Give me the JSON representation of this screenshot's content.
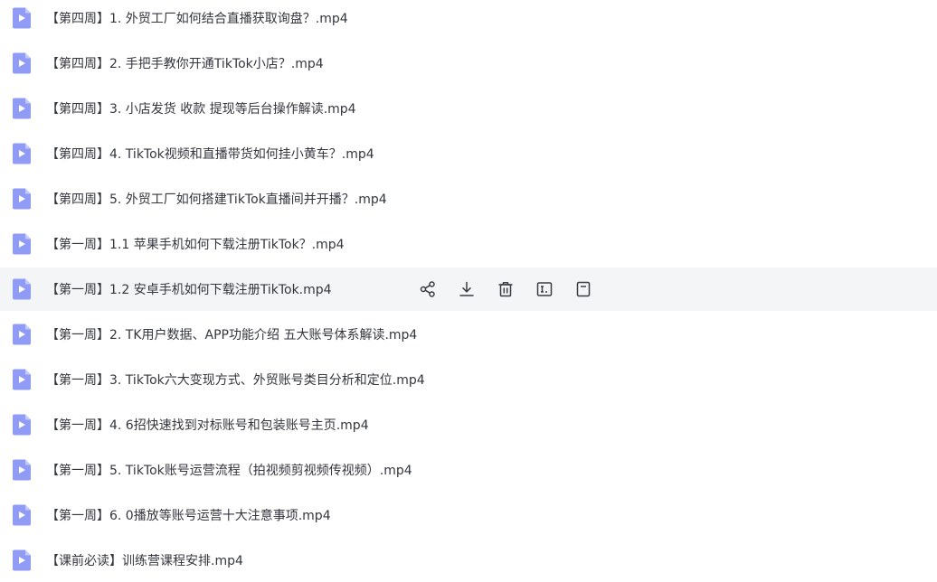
{
  "files": [
    {
      "name": "【第四周】1. 外贸工厂如何结合直播获取询盘？.mp4",
      "icon": "video-file-icon"
    },
    {
      "name": "【第四周】2. 手把手教你开通TikTok小店？.mp4",
      "icon": "video-file-icon"
    },
    {
      "name": "【第四周】3. 小店发货 收款 提现等后台操作解读.mp4",
      "icon": "video-file-icon"
    },
    {
      "name": "【第四周】4. TikTok视频和直播带货如何挂小黄车？.mp4",
      "icon": "video-file-icon"
    },
    {
      "name": "【第四周】5. 外贸工厂如何搭建TikTok直播间并开播？.mp4",
      "icon": "video-file-icon"
    },
    {
      "name": "【第一周】1.1 苹果手机如何下载注册TikTok？.mp4",
      "icon": "video-file-icon"
    },
    {
      "name": "【第一周】1.2 安卓手机如何下载注册TikTok.mp4",
      "icon": "video-file-icon"
    },
    {
      "name": "【第一周】2. TK用户数据、APP功能介绍 五大账号体系解读.mp4",
      "icon": "video-file-icon"
    },
    {
      "name": "【第一周】3. TikTok六大变现方式、外贸账号类目分析和定位.mp4",
      "icon": "video-file-icon"
    },
    {
      "name": "【第一周】4. 6招快速找到对标账号和包装账号主页.mp4",
      "icon": "video-file-icon"
    },
    {
      "name": "【第一周】5. TikTok账号运营流程（拍视频剪视频传视频）.mp4",
      "icon": "video-file-icon"
    },
    {
      "name": "【第一周】6. 0播放等账号运营十大注意事项.mp4",
      "icon": "video-file-icon"
    },
    {
      "name": "【课前必读】训练营课程安排.mp4",
      "icon": "video-file-icon"
    }
  ],
  "hovered_index": 6,
  "row_actions": [
    {
      "action": "share",
      "icon": "share-icon"
    },
    {
      "action": "download",
      "icon": "download-icon"
    },
    {
      "action": "delete",
      "icon": "trash-icon"
    },
    {
      "action": "rename",
      "icon": "rename-icon"
    },
    {
      "action": "more",
      "icon": "more-icon"
    }
  ],
  "colors": {
    "icon_fill": "#8f9bf5",
    "icon_fold": "#c4cbfa",
    "text": "#33363d",
    "hover_bg": "#f4f5f7",
    "action_icon": "#3a3d44"
  }
}
